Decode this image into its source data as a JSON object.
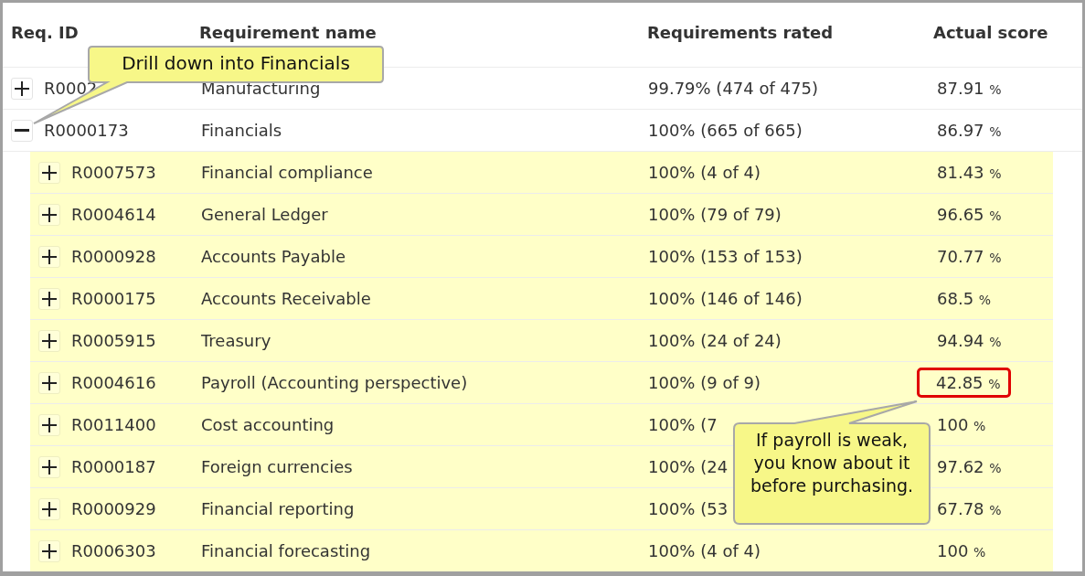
{
  "table": {
    "columns": [
      "Req. ID",
      "Requirement name",
      "Requirements rated",
      "Actual score"
    ],
    "rows": [
      {
        "id": "R0002",
        "name": "Manufacturing",
        "rated": "99.79% (474 of 475)",
        "score": "87.91",
        "unit": "%",
        "expanded": false,
        "flagged": false
      },
      {
        "id": "R0000173",
        "name": "Financials",
        "rated": "100% (665 of 665)",
        "score": "86.97",
        "unit": "%",
        "expanded": true,
        "flagged": false,
        "children": [
          {
            "id": "R0007573",
            "name": "Financial compliance",
            "rated": "100% (4 of 4)",
            "score": "81.43",
            "unit": "%",
            "expanded": false,
            "flagged": false
          },
          {
            "id": "R0004614",
            "name": "General Ledger",
            "rated": "100% (79 of 79)",
            "score": "96.65",
            "unit": "%",
            "expanded": false,
            "flagged": false
          },
          {
            "id": "R0000928",
            "name": "Accounts Payable",
            "rated": "100% (153 of 153)",
            "score": "70.77",
            "unit": "%",
            "expanded": false,
            "flagged": false
          },
          {
            "id": "R0000175",
            "name": "Accounts Receivable",
            "rated": "100% (146 of 146)",
            "score": "68.5",
            "unit": "%",
            "expanded": false,
            "flagged": false
          },
          {
            "id": "R0005915",
            "name": "Treasury",
            "rated": "100% (24 of 24)",
            "score": "94.94",
            "unit": "%",
            "expanded": false,
            "flagged": false
          },
          {
            "id": "R0004616",
            "name": "Payroll (Accounting perspective)",
            "rated": "100% (9 of 9)",
            "score": "42.85",
            "unit": "%",
            "expanded": false,
            "flagged": true
          },
          {
            "id": "R0011400",
            "name": "Cost accounting",
            "rated": "100% (7",
            "score": "100",
            "unit": "%",
            "expanded": false,
            "flagged": false
          },
          {
            "id": "R0000187",
            "name": "Foreign currencies",
            "rated": "100% (24",
            "score": "97.62",
            "unit": "%",
            "expanded": false,
            "flagged": false
          },
          {
            "id": "R0000929",
            "name": "Financial reporting",
            "rated": "100% (53",
            "score": "67.78",
            "unit": "%",
            "expanded": false,
            "flagged": false
          },
          {
            "id": "R0006303",
            "name": "Financial forecasting",
            "rated": "100% (4 of 4)",
            "score": "100",
            "unit": "%",
            "expanded": false,
            "flagged": false
          }
        ]
      }
    ]
  },
  "callouts": [
    {
      "text": "Drill down into Financials"
    },
    {
      "text": "If payroll is weak, you know about it before purchasing."
    }
  ]
}
